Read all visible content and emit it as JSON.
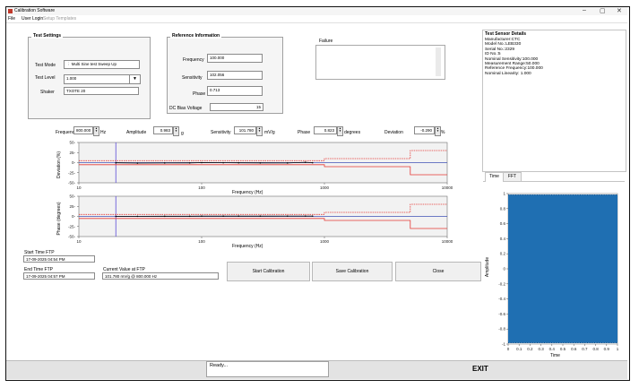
{
  "window": {
    "title": "Calibration Software",
    "minimize_glyph": "–",
    "maximize_glyph": "▢",
    "close_glyph": "✕"
  },
  "menu": {
    "file": "File",
    "user_login": "User Login",
    "setup_templates": "Setup Templates"
  },
  "test_settings": {
    "title": "Test Settings",
    "test_mode_label": "Test Mode",
    "test_mode_value": "Multi Sine test Sweep Up",
    "test_level_label": "Test Level",
    "test_level_value": "1.000",
    "shaker_label": "Shaker",
    "shaker_value": "TXOTE 20"
  },
  "reference_info": {
    "title": "Reference Information",
    "frequency_label": "Frequency",
    "frequency_value": "100.000",
    "sensitivity_label": "Sensitivity",
    "sensitivity_value": "102.056",
    "phase_label": "Phase",
    "phase_value": "0.713",
    "dc_bias_label": "DC Bias Voltage",
    "dc_bias_value": "15"
  },
  "failure": {
    "label": "Failure",
    "value": ""
  },
  "sensor_details": {
    "title": "Test Sensor Details",
    "lines": [
      "Manufacturer:CTC",
      "Model No.:LEB330",
      "Serial No.:2329",
      "ID No.:5",
      "Nominal Sensitivity:100.000",
      "Measurement Range:50.000",
      "Reference Frequency:100.000",
      "Nominal Linearity: 1.000"
    ]
  },
  "readout": {
    "frequency_label": "Frequency",
    "frequency_value": "800.000",
    "frequency_unit": "Hz",
    "amplitude_label": "Amplitude",
    "amplitude_value": "0.983",
    "amplitude_unit": "g",
    "sensitivity_label": "Sensitivity",
    "sensitivity_value": "101.780",
    "sensitivity_unit": "mV/g",
    "phase_label": "Phase",
    "phase_value": "0.823",
    "phase_unit": "degrees",
    "deviation_label": "Deviation",
    "deviation_value": "-0.290",
    "deviation_unit": "%"
  },
  "chart_data": [
    {
      "type": "line",
      "title": "",
      "xlabel": "Frequency (Hz)",
      "ylabel": "Deviation (%)",
      "xscale": "log",
      "xlim": [
        10,
        10000
      ],
      "ylim": [
        -50,
        50
      ],
      "xticks": [
        "10",
        "100",
        "1000",
        "10000"
      ],
      "yticks": [
        "50",
        "25",
        "0",
        "-25",
        "-50"
      ],
      "colors": {
        "limit_upper": "#e53935",
        "limit_lower": "#e53935",
        "measured": "#000000",
        "zero": "#3f51b5",
        "marker": "#5c4bd8"
      },
      "series": [
        {
          "x": [
            10,
            1000,
            1000,
            5000,
            5000,
            10000
          ],
          "values": [
            5,
            5,
            10,
            10,
            30,
            30
          ]
        },
        {
          "x": [
            10,
            1000,
            1000,
            5000,
            5000,
            10000
          ],
          "values": [
            -5,
            -5,
            -10,
            -10,
            -30,
            -30
          ]
        },
        {
          "x": [
            20,
            30,
            50,
            80,
            100,
            150,
            200,
            300,
            500,
            700,
            800
          ],
          "values": [
            -0.5,
            -1.2,
            -0.8,
            -0.6,
            0,
            -0.3,
            -0.4,
            -0.6,
            -0.8,
            0.8,
            -0.29
          ]
        }
      ]
    },
    {
      "type": "line",
      "title": "",
      "xlabel": "Frequency (Hz)",
      "ylabel": "Phase (degrees)",
      "xscale": "log",
      "xlim": [
        10,
        10000
      ],
      "ylim": [
        -50,
        50
      ],
      "xticks": [
        "10",
        "100",
        "1000",
        "10000"
      ],
      "yticks": [
        "50",
        "25",
        "0",
        "-25",
        "-50"
      ],
      "colors": {
        "limit_upper": "#e53935",
        "limit_lower": "#e53935",
        "measured": "#000000",
        "zero": "#3f51b5",
        "marker": "#5c4bd8"
      },
      "series": [
        {
          "x": [
            10,
            1000,
            1000,
            5000,
            5000,
            10000
          ],
          "values": [
            5,
            5,
            10,
            10,
            30,
            30
          ]
        },
        {
          "x": [
            10,
            1000,
            1000,
            5000,
            5000,
            10000
          ],
          "values": [
            -5,
            -5,
            -10,
            -10,
            -30,
            -30
          ]
        },
        {
          "x": [
            20,
            30,
            50,
            80,
            100,
            150,
            200,
            300,
            500,
            700,
            800
          ],
          "values": [
            0.2,
            0.3,
            0.4,
            0.5,
            0.71,
            0.6,
            0.7,
            0.75,
            0.8,
            0.82,
            0.823
          ]
        }
      ]
    },
    {
      "type": "area",
      "title": "",
      "xlabel": "Time",
      "ylabel": "Amplitude",
      "xlim": [
        0,
        1
      ],
      "ylim": [
        -1,
        1
      ],
      "xticks": [
        "0",
        "0.1",
        "0.2",
        "0.3",
        "0.4",
        "0.5",
        "0.6",
        "0.7",
        "0.8",
        "0.9",
        "1"
      ],
      "yticks": [
        "1",
        "0.8",
        "0.6",
        "0.4",
        "0.2",
        "0",
        "-0.2",
        "-0.4",
        "-0.6",
        "-0.8",
        "-1"
      ],
      "colors": {
        "signal": "#1f6fb2"
      },
      "series": [
        {
          "x": [
            0,
            1
          ],
          "values": [
            0.983,
            -0.983
          ]
        }
      ]
    }
  ],
  "tabs": {
    "time": "Time",
    "fft": "FFT"
  },
  "times": {
    "start_label": "Start Time FTP",
    "start_value": "17-09-2025 04:54 PM",
    "end_label": "End Time FTP",
    "end_value": "17-09-2025 04:57 PM",
    "current_label": "Current Value at FTP",
    "current_value": "101.780 mV/g @ 800.000 Hz"
  },
  "buttons": {
    "start": "Start Calibration",
    "save": "Save Calibration",
    "close": "Close"
  },
  "status": {
    "ready": "Ready...",
    "exit": "EXIT"
  }
}
